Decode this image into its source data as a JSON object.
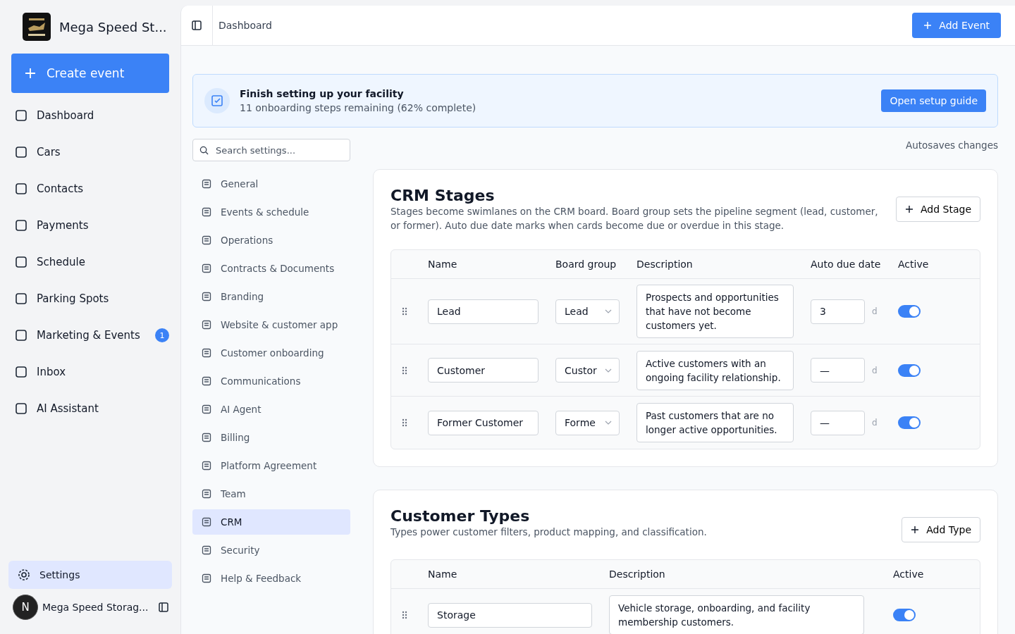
{
  "sidebar": {
    "brand": "Mega Speed St...",
    "create_button": "Create event",
    "items": [
      {
        "label": "Dashboard",
        "selected": false
      },
      {
        "label": "Cars",
        "selected": false
      },
      {
        "label": "Contacts",
        "selected": false
      },
      {
        "label": "Payments",
        "selected": false
      },
      {
        "label": "Schedule",
        "selected": false
      },
      {
        "label": "Parking Spots",
        "selected": false
      },
      {
        "label": "Marketing & Events",
        "selected": false,
        "badge": "1"
      },
      {
        "label": "Inbox",
        "selected": false
      },
      {
        "label": "AI Assistant",
        "selected": false
      }
    ],
    "settings": {
      "label": "Settings",
      "selected": true
    },
    "account": {
      "avatar": "N",
      "name": "Mega Speed Storag..."
    }
  },
  "header": {
    "breadcrumb": "Dashboard",
    "action": "Add Event"
  },
  "banner": {
    "title": "Finish setting up your facility",
    "subtitle": "11 onboarding steps remaining (62% complete)",
    "button": "Open setup guide"
  },
  "search": {
    "placeholder": "Search settings..."
  },
  "autosave": "Autosaves changes",
  "settings_nav": [
    {
      "label": "General",
      "selected": false
    },
    {
      "label": "Events & schedule",
      "selected": false
    },
    {
      "label": "Operations",
      "selected": false
    },
    {
      "label": "Contracts & Documents",
      "selected": false
    },
    {
      "label": "Branding",
      "selected": false
    },
    {
      "label": "Website & customer app",
      "selected": false
    },
    {
      "label": "Customer onboarding",
      "selected": false
    },
    {
      "label": "Communications",
      "selected": false
    },
    {
      "label": "AI Agent",
      "selected": false
    },
    {
      "label": "Billing",
      "selected": false
    },
    {
      "label": "Platform Agreement",
      "selected": false
    },
    {
      "label": "Team",
      "selected": false
    },
    {
      "label": "CRM",
      "selected": true
    },
    {
      "label": "Security",
      "selected": false
    },
    {
      "label": "Help & Feedback",
      "selected": false
    }
  ],
  "crm_stages": {
    "title": "CRM Stages",
    "description": "Stages become swimlanes on the CRM board. Board group sets the pipeline segment (lead, customer, or former). Auto due date marks when cards become due or overdue in this stage.",
    "button": "Add Stage",
    "columns": [
      "Name",
      "Board group",
      "Description",
      "Auto due date",
      "Active"
    ],
    "rows": [
      {
        "name": "Lead",
        "group": "Lead",
        "description": "Prospects and opportunities that have not become customers yet.",
        "due": "3",
        "unit": "d",
        "on": true
      },
      {
        "name": "Customer",
        "group": "Custor",
        "description": "Active customers with an ongoing facility relationship.",
        "due": "—",
        "unit": "d",
        "on": true
      },
      {
        "name": "Former Customer",
        "group": "Forme",
        "description": "Past customers that are no longer active opportunities.",
        "due": "—",
        "unit": "d",
        "on": true
      }
    ]
  },
  "customer_types": {
    "title": "Customer Types",
    "description": "Types power customer filters, product mapping, and classification.",
    "button": "Add Type",
    "columns": [
      "Name",
      "Description",
      "Active"
    ],
    "rows": [
      {
        "name": "Storage",
        "description": "Vehicle storage, onboarding, and facility membership customers.",
        "on": true
      }
    ]
  }
}
